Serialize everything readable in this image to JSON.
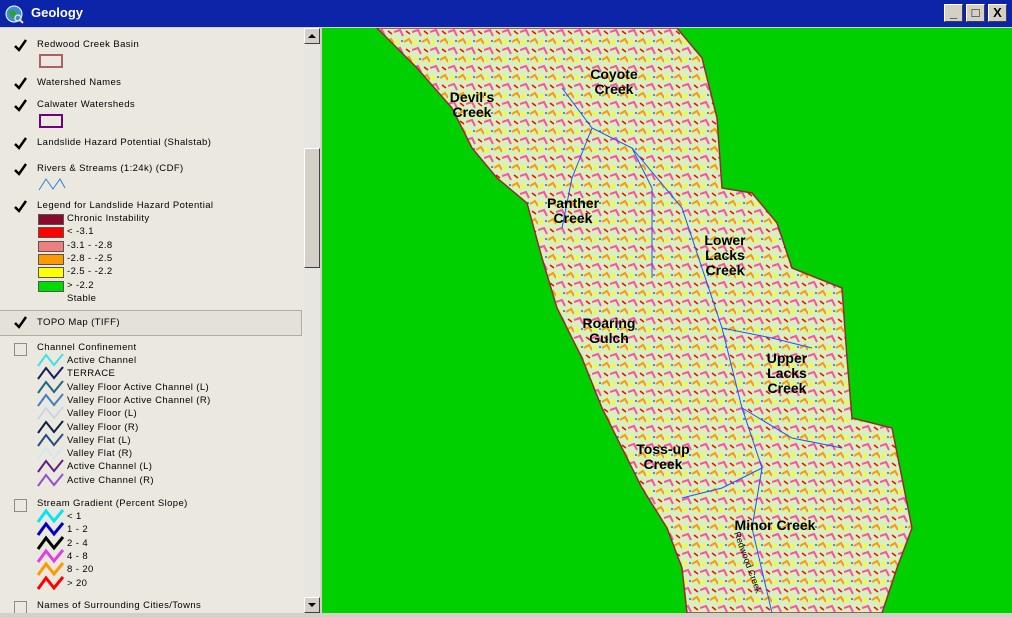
{
  "window": {
    "title": "Geology",
    "minimize": "_",
    "maximize": "□",
    "close": "X"
  },
  "toc": {
    "layers": [
      {
        "name": "Redwood Creek Basin",
        "checked": true
      },
      {
        "name": "Watershed Names",
        "checked": true
      },
      {
        "name": "Calwater Watersheds",
        "checked": true
      },
      {
        "name": "Landslide Hazard Potential (Shalstab)",
        "checked": true
      },
      {
        "name": "Rivers & Streams (1:24k) (CDF)",
        "checked": true
      },
      {
        "name": "Legend for Landslide Hazard Potential",
        "checked": true
      },
      {
        "name": "TOPO Map (TIFF)",
        "checked": true
      },
      {
        "name": "Channel Confinement",
        "checked": false
      },
      {
        "name": "Stream Gradient (Percent Slope)",
        "checked": false
      },
      {
        "name": "Names of Surrounding Cities/Towns",
        "checked": false
      }
    ],
    "landslide_legend": [
      {
        "label": "Chronic Instability",
        "color": "#8b0a2a"
      },
      {
        "label": "<  -3.1",
        "color": "#ff0000"
      },
      {
        "label": "-3.1 - -2.8",
        "color": "#f08080"
      },
      {
        "label": "-2.8 - -2.5",
        "color": "#ff9900"
      },
      {
        "label": "-2.5 - -2.2",
        "color": "#ffff00"
      },
      {
        "label": "> -2.2",
        "color": "#00dd00"
      },
      {
        "label": "Stable",
        "color": ""
      }
    ],
    "channel_confinement": [
      {
        "label": "Active Channel",
        "color": "#40e0e8"
      },
      {
        "label": "TERRACE",
        "color": "#102060"
      },
      {
        "label": "Valley Floor Active Channel (L)",
        "color": "#206880"
      },
      {
        "label": "Valley Floor Active Channel (R)",
        "color": "#4080c0"
      },
      {
        "label": "Valley Floor (L)",
        "color": "#c8d8e8"
      },
      {
        "label": "Valley Floor (R)",
        "color": "#102040"
      },
      {
        "label": "Valley Flat (L)",
        "color": "#205080"
      },
      {
        "label": "Valley Flat (R)",
        "color": "#d0e8f0"
      },
      {
        "label": "Active Channel (L)",
        "color": "#602080"
      },
      {
        "label": "Active Channel (R)",
        "color": "#9050d0"
      }
    ],
    "stream_gradient": [
      {
        "label": "< 1",
        "color": "#00e8f0"
      },
      {
        "label": "1 - 2",
        "color": "#0000c0"
      },
      {
        "label": "2 - 4",
        "color": "#000000"
      },
      {
        "label": "4 - 8",
        "color": "#e040e0"
      },
      {
        "label": "8 - 20",
        "color": "#ff9900"
      },
      {
        "label": "> 20",
        "color": "#ff0000"
      }
    ]
  },
  "map": {
    "background_color": "#00d000",
    "watersheds": [
      "Coyote Creek",
      "Devil's Creek",
      "Panther Creek",
      "Lower Lacks Creek",
      "Roaring Gulch",
      "Upper Lacks Creek",
      "Toss-up Creek",
      "Minor Creek"
    ],
    "stream_label": "Redwood Creek"
  }
}
